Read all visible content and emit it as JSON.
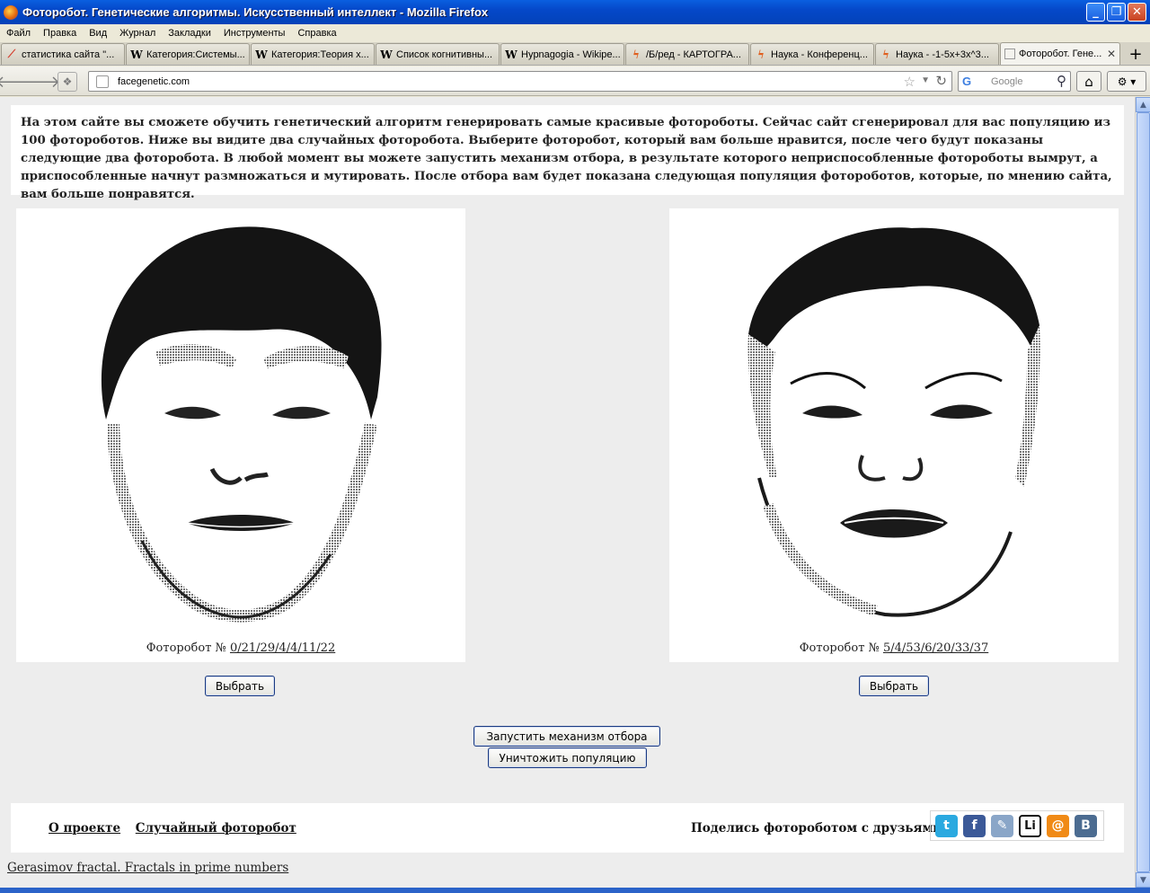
{
  "window": {
    "title": "Фоторобот. Генетические алгоритмы. Искусственный интеллект - Mozilla Firefox",
    "buttons": {
      "minimize": "_",
      "maximize": "❐",
      "close": "✕"
    }
  },
  "menu": [
    "Файл",
    "Правка",
    "Вид",
    "Журнал",
    "Закладки",
    "Инструменты",
    "Справка"
  ],
  "tabs": [
    {
      "label": "статистика сайта \"...",
      "icon": "stats-icon",
      "glyph": "⟋",
      "color": "#d43c2c"
    },
    {
      "label": "Категория:Системы...",
      "icon": "wikipedia-icon",
      "glyph": "W",
      "color": "#333333"
    },
    {
      "label": "Категория:Теория х...",
      "icon": "wikipedia-icon",
      "glyph": "W",
      "color": "#333333"
    },
    {
      "label": "Список когнитивны...",
      "icon": "wikipedia-icon",
      "glyph": "W",
      "color": "#333333"
    },
    {
      "label": "Hypnagogia - Wikipe...",
      "icon": "wikipedia-icon",
      "glyph": "W",
      "color": "#333333"
    },
    {
      "label": "/Б/ред - КАРТОГРА...",
      "icon": "lightning-icon",
      "glyph": "ϟ",
      "color": "#e06020"
    },
    {
      "label": "Наука - Конференц...",
      "icon": "lightning-icon",
      "glyph": "ϟ",
      "color": "#e06020"
    },
    {
      "label": "Наука - -1-5x+3x^3...",
      "icon": "lightning-icon",
      "glyph": "ϟ",
      "color": "#e06020"
    },
    {
      "label": "Фоторобот. Гене...",
      "icon": "page-icon",
      "glyph": "",
      "color": "#999999",
      "active": true
    }
  ],
  "nav": {
    "url": "facegenetic.com",
    "search_placeholder": "Google"
  },
  "intro_text": "На этом сайте вы сможете обучить генетический алгоритм генерировать самые красивые фотороботы. Сейчас сайт сгенерировал для вас популяцию из 100 фотороботов. Ниже вы видите два случайных фоторобота. Выберите фоторобот, который вам больше нравится, после чего будут показаны следующие два фоторобота. В любой момент вы можете запустить механизм отбора, в результате которого неприспособленные фотороботы вымрут, а приспособленные начнут размножаться и мутировать. После отбора вам будет показана следующая популяция фотороботов, которые, по мнению сайта, вам больше понравятся.",
  "faces": [
    {
      "caption_prefix": "Фоторобот № ",
      "id": "0/21/29/4/4/11/22",
      "choose_label": "Выбрать"
    },
    {
      "caption_prefix": "Фоторобот № ",
      "id": "5/4/53/6/20/33/37",
      "choose_label": "Выбрать"
    }
  ],
  "actions": {
    "run_selection": "Запустить механизм отбора",
    "destroy_population": "Уничтожить популяцию"
  },
  "footer": {
    "about": "О проекте",
    "random": "Случайный фоторобот",
    "share": "Поделись фотороботом с друзьями!",
    "socials": [
      {
        "name": "twitter-icon",
        "glyph": "t",
        "color": "#2aa9e0"
      },
      {
        "name": "facebook-icon",
        "glyph": "f",
        "color": "#3b5998"
      },
      {
        "name": "livejournal-icon",
        "glyph": "✎",
        "color": "#8aa6c8"
      },
      {
        "name": "liveinternet-icon",
        "glyph": "Li",
        "color": "#ffffff"
      },
      {
        "name": "mailru-icon",
        "glyph": "@",
        "color": "#f08a16"
      },
      {
        "name": "vkontakte-icon",
        "glyph": "B",
        "color": "#4c6c91"
      }
    ]
  },
  "bottom_link": "Gerasimov fractal. Fractals in prime numbers",
  "colors": {
    "titlebar": "#0548c9",
    "page_bg": "#ededed",
    "button_border": "#1b3b82"
  }
}
